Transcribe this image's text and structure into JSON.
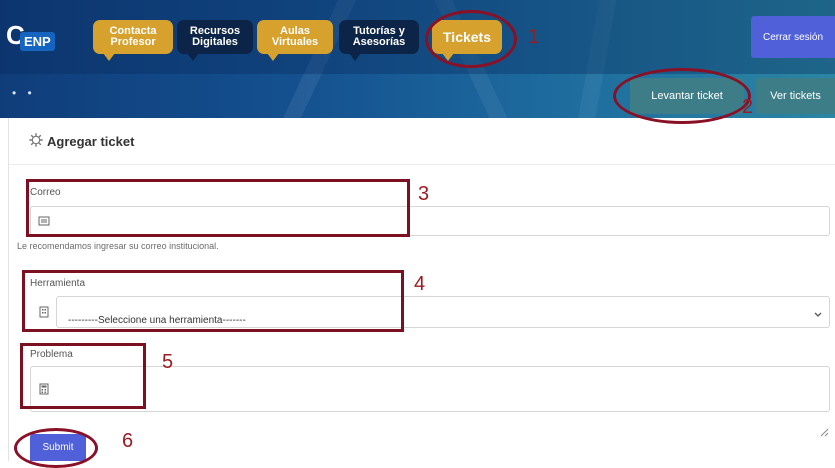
{
  "header": {
    "logo": {
      "letter": "C",
      "text": "ENP"
    },
    "nav": [
      {
        "label": "Contacta Profesor",
        "style": "gold"
      },
      {
        "label": "Recursos Digitales",
        "style": "navy"
      },
      {
        "label": "Aulas Virtuales",
        "style": "gold"
      },
      {
        "label": "Tutorías y Asesorías",
        "style": "navy"
      },
      {
        "label": "Tickets",
        "style": "gold"
      }
    ],
    "logout_label": "Cerrar sesión",
    "dots": "• •",
    "sub_nav": [
      {
        "label": "Levantar ticket"
      },
      {
        "label": "Ver tickets"
      }
    ]
  },
  "card": {
    "title": "Agregar ticket",
    "fields": {
      "email": {
        "label": "Correo",
        "value": "",
        "help": "Le recomendamos ingresar su correo institucional."
      },
      "tool": {
        "label": "Herramienta",
        "selected": "---------Seleccione una herramienta-------"
      },
      "problem": {
        "label": "Problema",
        "value": ""
      }
    },
    "submit_label": "Submit"
  },
  "annotations": [
    "1",
    "2",
    "3",
    "4",
    "5",
    "6"
  ],
  "colors": {
    "primary": "#5060d8",
    "gold": "#d6a22d",
    "navy": "#0b2447",
    "teal": "#3d7d87",
    "annotation": "#7a1022"
  }
}
